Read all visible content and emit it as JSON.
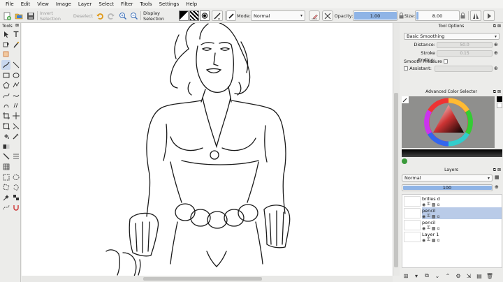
{
  "menu": [
    "File",
    "Edit",
    "View",
    "Image",
    "Layer",
    "Select",
    "Filter",
    "Tools",
    "Settings",
    "Help"
  ],
  "toolbar": {
    "invert_selection": "Invert Selection",
    "deselect": "Deselect",
    "display_selection": "Display Selection",
    "mode_label": "Mode:",
    "mode_value": "Normal",
    "opacity_label": "Opacity:",
    "opacity_value": "1.00",
    "size_label": "Size:",
    "size_value": "8.00"
  },
  "tools_panel": {
    "title": "Tools"
  },
  "tool_options": {
    "title": "Tool Options",
    "smoothing": "Basic Smoothing",
    "distance_label": "Distance:",
    "distance_value": "50.0",
    "stroke_ending_label": "Stroke Ending:",
    "stroke_ending_value": "0.15",
    "smooth_pressure_label": "Smooth Pressure",
    "assistant_label": "Assistant:"
  },
  "color_selector": {
    "title": "Advanced Color Selector"
  },
  "layers": {
    "title": "Layers",
    "blend_mode": "Normal",
    "opacity": "100",
    "items": [
      {
        "name": "brilles d",
        "active": false
      },
      {
        "name": "pencil",
        "active": true
      },
      {
        "name": "pencil",
        "active": false
      },
      {
        "name": "Layer 1",
        "active": false
      }
    ]
  },
  "colors": {
    "accent": "#8fb4e6",
    "active_layer": "#b9cbe8"
  }
}
